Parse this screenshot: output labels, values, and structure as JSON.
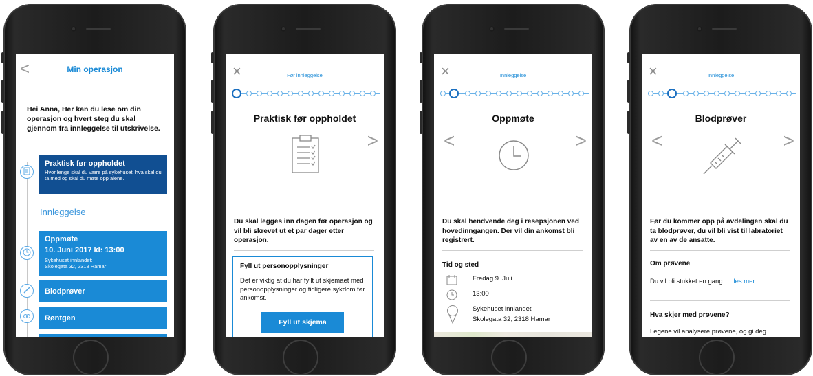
{
  "screen1": {
    "header": {
      "back_glyph": "<",
      "title": "Min operasjon"
    },
    "intro": "Hei Anna, Her kan du lese om din operasjon og hvert steg du skal gjennom fra innleggelse til utskrivelse.",
    "section_label": "Innleggelse",
    "cards": {
      "practical": {
        "title": "Praktisk før oppholdet",
        "subtitle": "Hvor lenge skal du være på sykehuset, hva skal du ta med og skal du møte opp alene."
      },
      "attendance": {
        "title": "Oppmøte",
        "date": "10. Juni 2017  kl: 13:00",
        "loc1": "Sykehuset innlandet:",
        "loc2": "Skolegata 32, 2318 Hamar"
      },
      "blood": {
        "title": "Blodprøver"
      },
      "xray": {
        "title": "Røntgen"
      }
    },
    "icons": [
      "document-icon",
      "clock-icon",
      "syringe-icon",
      "xray-icon"
    ]
  },
  "screen2": {
    "close_glyph": "×",
    "step_label": "Før innleggelse",
    "title": "Praktisk før oppholdet",
    "arrow_right": ">",
    "body": "Du skal legges inn dagen før operasjon og vil bli skrevet ut et par dager etter operasjon.",
    "box": {
      "heading": "Fyll ut personopplysninger",
      "text": "Det er viktig at du har fyllt ut skjemaet med personopplysninger og tidligere sykdom før ankomst.",
      "button": "Fyll ut skjema"
    },
    "active_step": 0
  },
  "screen3": {
    "close_glyph": "×",
    "step_label": "Innleggelse",
    "title": "Oppmøte",
    "arrow_left": "<",
    "arrow_right": ">",
    "body": "Du skal hendvende deg i resepsjonen ved hovedinngangen. Der vil din ankomst bli registrert.",
    "info_heading": "Tid og sted",
    "date": "Fredag 9. Juli",
    "time": "13:00",
    "place1": "Sykehuset innlandet",
    "place2": "Skolegata 32, 2318 Hamar",
    "active_step": 1
  },
  "screen4": {
    "close_glyph": "×",
    "step_label": "Innleggelse",
    "title": "Blodprøver",
    "arrow_left": "<",
    "arrow_right": ">",
    "body": "Før du kommer opp på avdelingen skal du ta blodprøver, du vil bli vist til labratoriet av en av de ansatte.",
    "about_heading": "Om prøvene",
    "about_text": "Du vil bli stukket en gang .....",
    "read_more": "les mer",
    "what_heading": "Hva skjer med prøvene?",
    "what_text": "Legene vil analysere prøvene, og gi deg",
    "active_step": 2
  },
  "colors": {
    "accent": "#1a8ad6",
    "dark_card": "#114f92"
  }
}
